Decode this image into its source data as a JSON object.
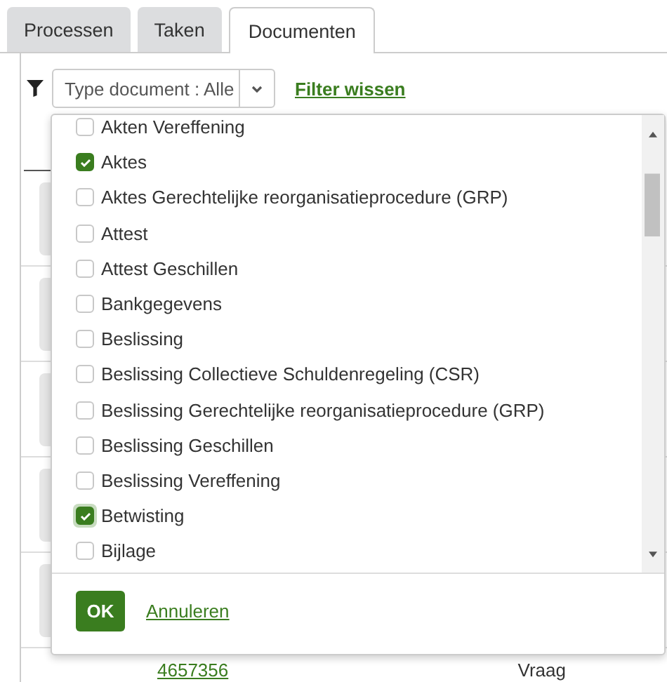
{
  "tabs": [
    {
      "label": "Processen",
      "selected": false
    },
    {
      "label": "Taken",
      "selected": false
    },
    {
      "label": "Documenten",
      "selected": true
    }
  ],
  "filter": {
    "select_value": "Type document : Alle",
    "clear_link": "Filter wissen"
  },
  "dropdown": {
    "options": [
      {
        "label": "Akten Vereffening",
        "checked": false,
        "focused": false
      },
      {
        "label": "Aktes",
        "checked": true,
        "focused": false
      },
      {
        "label": "Aktes Gerechtelijke reorganisatieprocedure (GRP)",
        "checked": false,
        "focused": false
      },
      {
        "label": "Attest",
        "checked": false,
        "focused": false
      },
      {
        "label": "Attest Geschillen",
        "checked": false,
        "focused": false
      },
      {
        "label": "Bankgegevens",
        "checked": false,
        "focused": false
      },
      {
        "label": "Beslissing",
        "checked": false,
        "focused": false
      },
      {
        "label": "Beslissing Collectieve Schuldenregeling (CSR)",
        "checked": false,
        "focused": false
      },
      {
        "label": "Beslissing Gerechtelijke reorganisatieprocedure (GRP)",
        "checked": false,
        "focused": false
      },
      {
        "label": "Beslissing Geschillen",
        "checked": false,
        "focused": false
      },
      {
        "label": "Beslissing Vereffening",
        "checked": false,
        "focused": false
      },
      {
        "label": "Betwisting",
        "checked": true,
        "focused": true
      },
      {
        "label": "Bijlage",
        "checked": false,
        "focused": false
      }
    ],
    "ok_button": "OK",
    "cancel_link": "Annuleren"
  },
  "table": {
    "rows": [
      {
        "column_2": "4657356",
        "column_3": "Vraag"
      }
    ]
  }
}
